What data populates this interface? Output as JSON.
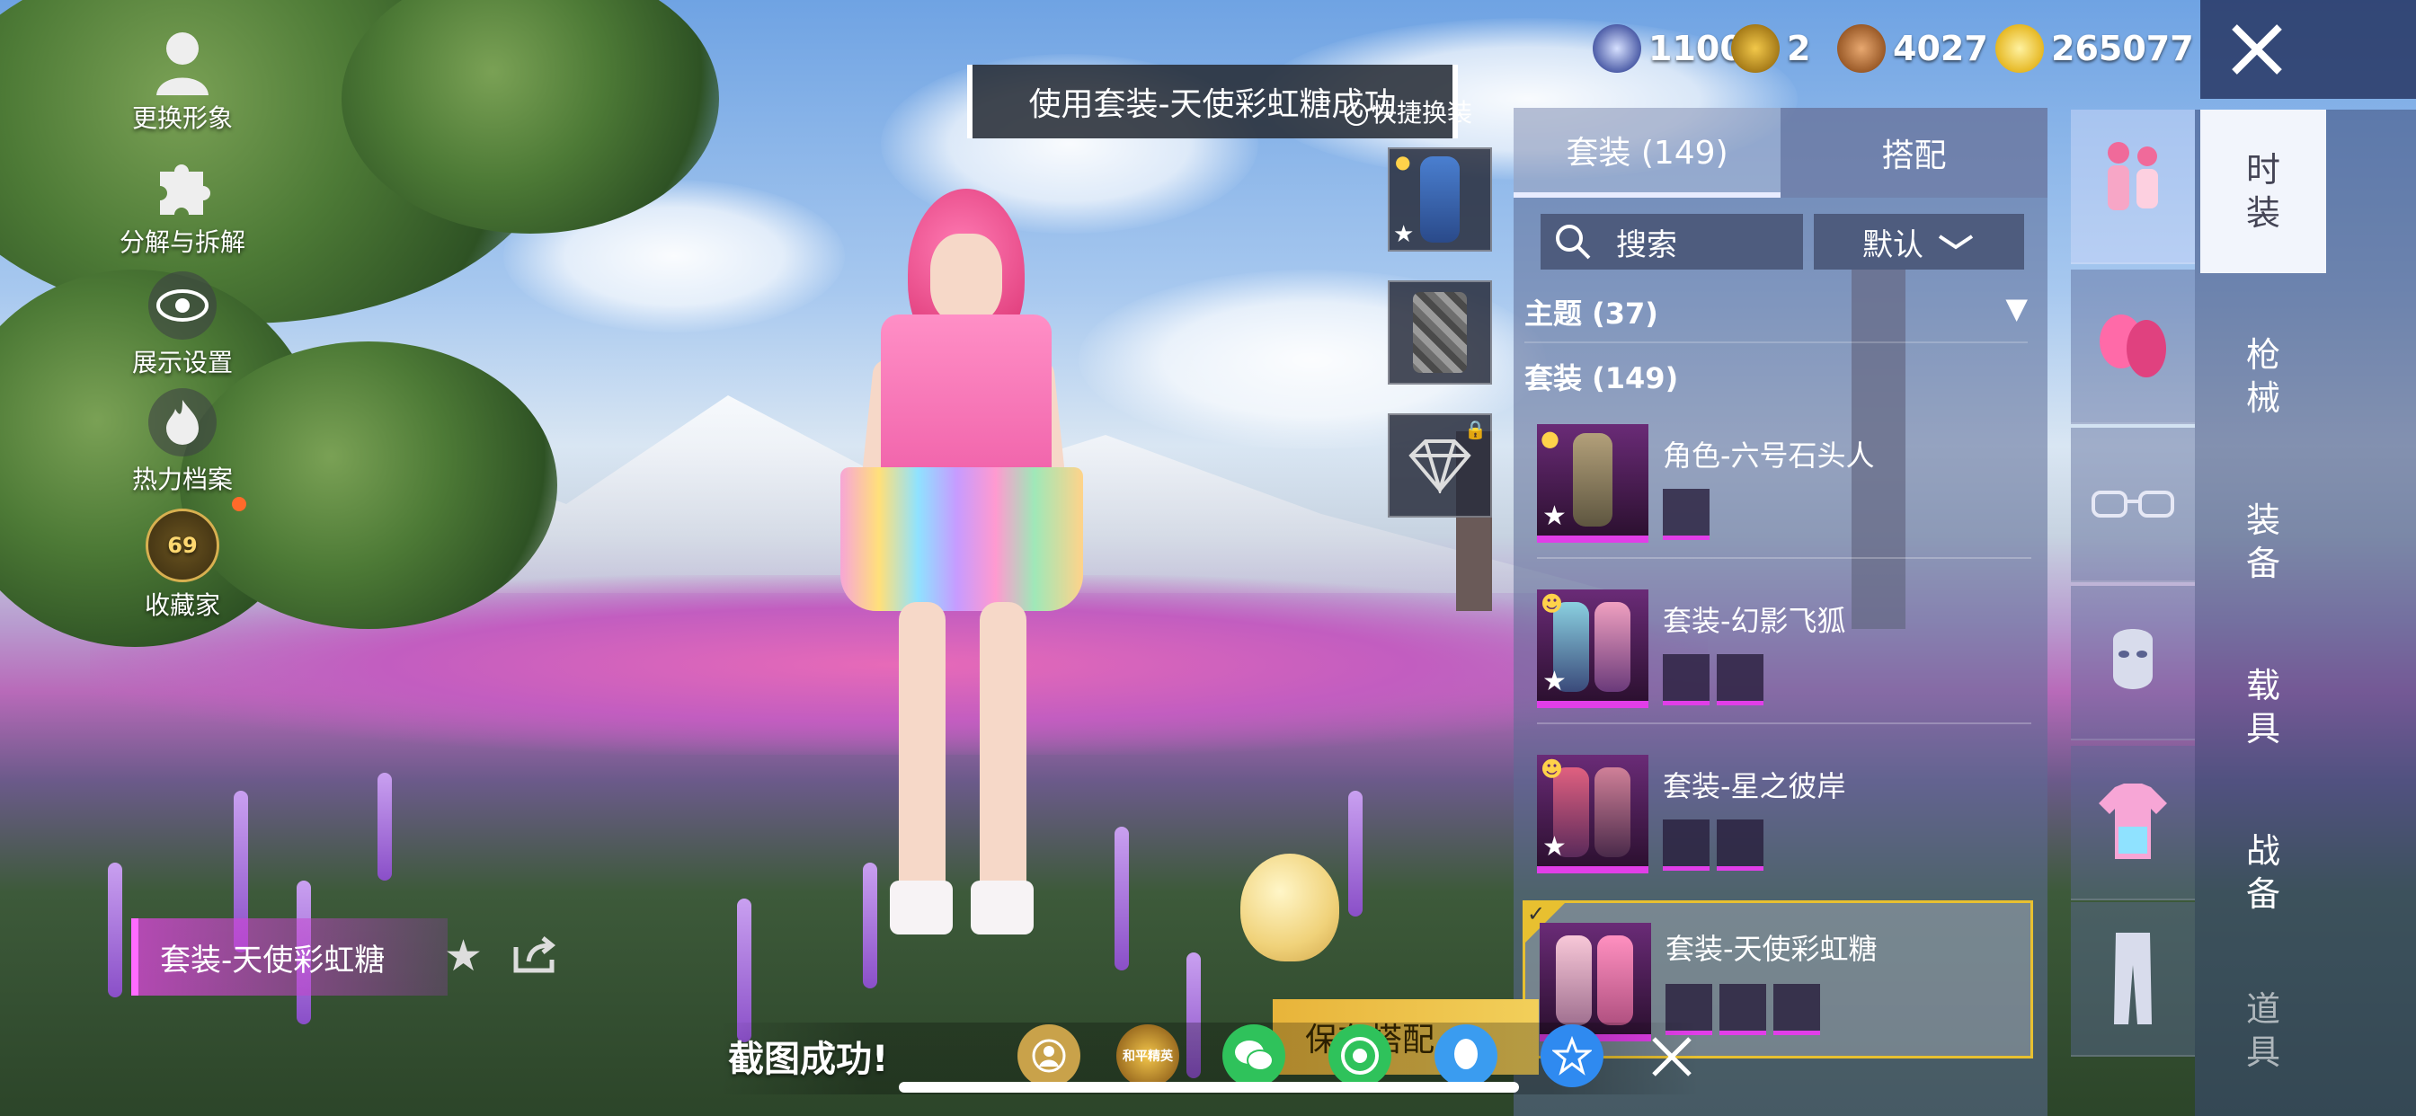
{
  "toast": "使用套装-天使彩虹糖成功",
  "quick_swap": "快捷换装",
  "left_menu": [
    "更换形象",
    "分解与拆解",
    "展示设置",
    "热力档案",
    "收藏家"
  ],
  "collector_level": "69",
  "outfit_name": "套装-天使彩虹糖",
  "currencies": [
    "1100",
    "2",
    "4027",
    "265077"
  ],
  "tabs": [
    "套装 (149)",
    "搭配"
  ],
  "search": {
    "placeholder": "搜索"
  },
  "sort": {
    "selected": "默认"
  },
  "sections": [
    "主题 (37)",
    "套装 (149)"
  ],
  "items": [
    {
      "name": "角色-六号石头人"
    },
    {
      "name": "套装-幻影飞狐"
    },
    {
      "name": "套装-星之彼岸"
    },
    {
      "name": "套装-天使彩虹糖",
      "selected": true
    }
  ],
  "main_tabs": [
    "时装",
    "枪械",
    "装备",
    "载具",
    "战备",
    "道具"
  ],
  "save_match": "保存搭配",
  "screenshot_text": "截图成功!",
  "share_targets": [
    "avatar",
    "和平精英",
    "wechat",
    "moments",
    "qq",
    "qzone"
  ],
  "colors": {
    "accent_magenta": "#e13ee8",
    "selected_gold": "#e8c030",
    "panel_bg": "#5c6c96"
  }
}
